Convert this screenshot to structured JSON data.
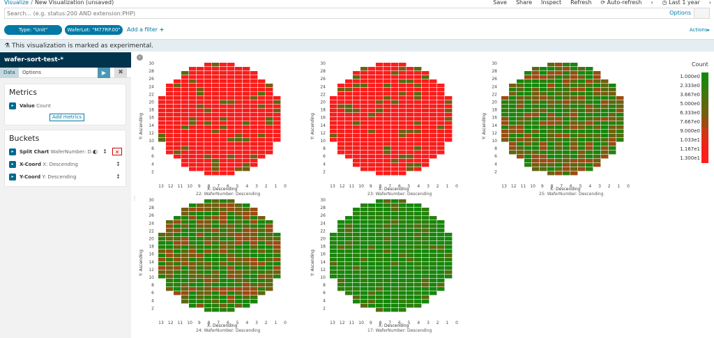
{
  "header": {
    "breadcrumb_link": "Visualize",
    "breadcrumb_current": "New Visualization (unsaved)",
    "menu": [
      "Save",
      "Share",
      "Inspect",
      "Refresh"
    ],
    "auto_refresh": "Auto-refresh",
    "time_range": "Last 1 year",
    "clock_icon": "clock-icon",
    "refresh_icon": "refresh-icon"
  },
  "search": {
    "placeholder": "Search... (e.g. status:200 AND extension:PHP)",
    "options_label": "Options"
  },
  "filters": {
    "pills": [
      "Type: \"Unit\"",
      "WaferLot: \"M77RP.00\""
    ],
    "add_filter": "Add a filter",
    "actions": "Actions"
  },
  "banner": {
    "text": "This visualization is marked as experimental.",
    "icon": "flask-icon"
  },
  "sidebar": {
    "index_pattern": "wafer-sort-test-*",
    "tabs": [
      "Data",
      "Options"
    ],
    "metrics_title": "Metrics",
    "metric": {
      "name": "Value",
      "desc": "Count"
    },
    "add_metrics": "Add metrics",
    "buckets_title": "Buckets",
    "buckets": [
      {
        "name": "Split Chart",
        "desc": "WaferNumber: D..."
      },
      {
        "name": "X-Coord",
        "desc": "X: Descending"
      },
      {
        "name": "Y-Coord",
        "desc": "Y: Descending"
      }
    ]
  },
  "colors": {
    "high": "#ff1c1c",
    "low": "#17870c",
    "mid": "#6b5a12",
    "accent": "#0079a5"
  },
  "chart_data": {
    "type": "heatmap",
    "xlabel": "X: Descending",
    "ylabel": "Y: Ascending",
    "x_ticks": [
      "13",
      "12",
      "11",
      "10",
      "9",
      "8",
      "7",
      "6",
      "5",
      "4",
      "3",
      "2",
      "1",
      "0"
    ],
    "y_ticks": [
      "30",
      "28",
      "26",
      "24",
      "22",
      "20",
      "18",
      "16",
      "14",
      "12",
      "10",
      "8",
      "6",
      "4",
      "2"
    ],
    "legend_title": "Count",
    "legend": [
      "1.000e0",
      "2.333e0",
      "3.667e0",
      "5.000e0",
      "6.333e0",
      "7.667e0",
      "9.000e0",
      "1.033e1",
      "1.167e1",
      "1.300e1"
    ],
    "legend_colors": [
      "#17870c",
      "#2b7f0b",
      "#44740c",
      "#5b690f",
      "#745e10",
      "#9a4c12",
      "#c63a15",
      "#e52a17",
      "#f51f1a",
      "#ff1c1c"
    ],
    "wafers": [
      {
        "title": "22: WaferNumber: Descending",
        "dominant": "red"
      },
      {
        "title": "23: WaferNumber: Descending",
        "dominant": "red"
      },
      {
        "title": "25: WaferNumber: Descending",
        "dominant": "mixed"
      },
      {
        "title": "24: WaferNumber: Descending",
        "dominant": "mixed"
      },
      {
        "title": "17: WaferNumber: Descending",
        "dominant": "green"
      }
    ]
  }
}
